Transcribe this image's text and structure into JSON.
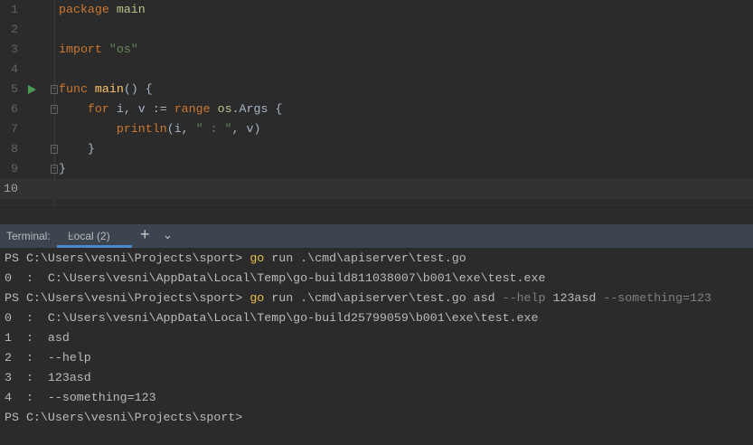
{
  "editor": {
    "lines": [
      {
        "n": "1",
        "parts": [
          [
            "kw",
            "package"
          ],
          [
            "",
            "",
            " "
          ],
          [
            "pkg",
            "main"
          ]
        ]
      },
      {
        "n": "2",
        "parts": []
      },
      {
        "n": "3",
        "parts": [
          [
            "kw",
            "import"
          ],
          [
            "",
            "",
            " "
          ],
          [
            "str",
            "\"os\""
          ]
        ]
      },
      {
        "n": "4",
        "parts": []
      },
      {
        "n": "5",
        "parts": [
          [
            "kw",
            "func"
          ],
          [
            "",
            "",
            " "
          ],
          [
            "fn",
            "main"
          ],
          [
            "",
            "() {"
          ]
        ]
      },
      {
        "n": "6",
        "parts": [
          [
            "",
            "    "
          ],
          [
            "kw",
            "for"
          ],
          [
            "",
            " i, v := "
          ],
          [
            "kw",
            "range"
          ],
          [
            "",
            " "
          ],
          [
            "pkg",
            "os"
          ],
          [
            "",
            ".Args {"
          ]
        ]
      },
      {
        "n": "7",
        "parts": [
          [
            "",
            "        "
          ],
          [
            "bi",
            "println"
          ],
          [
            "",
            "(i, "
          ],
          [
            "str",
            "\" : \""
          ],
          [
            "",
            ", v)"
          ]
        ]
      },
      {
        "n": "8",
        "parts": [
          [
            "",
            "    }"
          ]
        ]
      },
      {
        "n": "9",
        "parts": [
          [
            "",
            "}"
          ]
        ]
      },
      {
        "n": "10",
        "parts": []
      }
    ]
  },
  "terminal": {
    "label": "Terminal:",
    "tab": "Local (2)",
    "close": "×",
    "add": "+",
    "more": "⌄",
    "lines": [
      [
        [
          "",
          "PS C:\\Users\\vesni\\Projects\\sport> "
        ],
        [
          "go",
          "go"
        ],
        [
          "",
          " run .\\cmd\\apiserver\\test.go"
        ]
      ],
      [
        [
          "",
          "0  :  C:\\Users\\vesni\\AppData\\Local\\Temp\\go-build811038007\\b001\\exe\\test.exe"
        ]
      ],
      [
        [
          "",
          "PS C:\\Users\\vesni\\Projects\\sport> "
        ],
        [
          "go",
          "go"
        ],
        [
          "",
          " run .\\cmd\\apiserver\\test.go asd "
        ],
        [
          "opt",
          "--help"
        ],
        [
          "",
          " 123asd "
        ],
        [
          "opt",
          "--something=123"
        ]
      ],
      [
        [
          "",
          "0  :  C:\\Users\\vesni\\AppData\\Local\\Temp\\go-build25799059\\b001\\exe\\test.exe"
        ]
      ],
      [
        [
          "",
          "1  :  asd"
        ]
      ],
      [
        [
          "",
          "2  :  --help"
        ]
      ],
      [
        [
          "",
          "3  :  123asd"
        ]
      ],
      [
        [
          "",
          "4  :  --something=123"
        ]
      ],
      [
        [
          "",
          "PS C:\\Users\\vesni\\Projects\\sport>"
        ]
      ]
    ]
  }
}
